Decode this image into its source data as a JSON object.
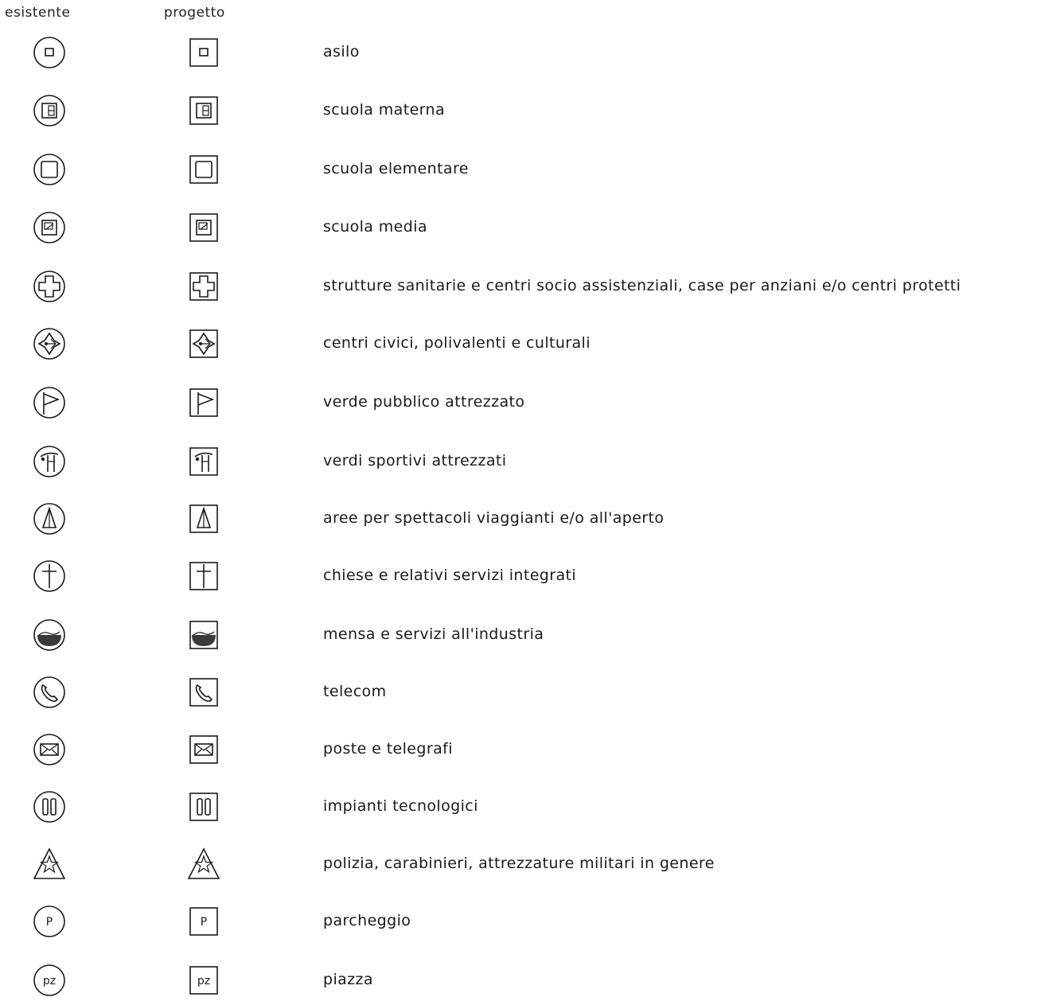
{
  "header": {
    "existing_label": "esistente",
    "project_label": "progetto"
  },
  "legend": [
    {
      "icon": "asilo-icon",
      "label": "asilo"
    },
    {
      "icon": "scuola-materna-icon",
      "label": "scuola materna"
    },
    {
      "icon": "scuola-elementare-icon",
      "label": "scuola elementare"
    },
    {
      "icon": "scuola-media-icon",
      "label": "scuola media"
    },
    {
      "icon": "sanitary-cross-icon",
      "label": "strutture sanitarie e centri socio assistenziali, case per anziani e/o centri protetti"
    },
    {
      "icon": "civic-center-icon",
      "label": "centri civici, polivalenti e culturali"
    },
    {
      "icon": "flag-icon",
      "label": "verde pubblico attrezzato"
    },
    {
      "icon": "sport-icon",
      "label": "verdi sportivi attrezzati"
    },
    {
      "icon": "tent-icon",
      "label": "aree per spettacoli viaggianti e/o all'aperto"
    },
    {
      "icon": "church-cross-icon",
      "label": "chiese e relativi servizi integrati"
    },
    {
      "icon": "canteen-icon",
      "label": "mensa e servizi all'industria"
    },
    {
      "icon": "phone-icon",
      "label": "telecom"
    },
    {
      "icon": "mail-icon",
      "label": "poste e telegrafi"
    },
    {
      "icon": "technical-plant-icon",
      "label": "impianti tecnologici"
    },
    {
      "icon": "police-star-icon",
      "label": "polizia, carabinieri, attrezzature militari in genere"
    },
    {
      "icon": "parking-icon",
      "label": "parcheggio",
      "symbol_text": "P"
    },
    {
      "icon": "square-plaza-icon",
      "label": "piazza",
      "symbol_text": "pz"
    }
  ]
}
